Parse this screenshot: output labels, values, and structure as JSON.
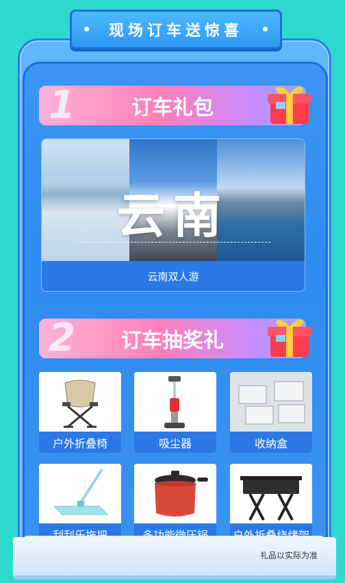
{
  "header": {
    "title": "现场订车送惊喜"
  },
  "section1": {
    "number": "1",
    "title": "订车礼包"
  },
  "yunnan": {
    "overlay": "云南",
    "caption": "云南双人游"
  },
  "section2": {
    "number": "2",
    "title": "订车抽奖礼"
  },
  "prizes": [
    {
      "label": "户外折叠椅",
      "icon": "folding-chair-icon"
    },
    {
      "label": "吸尘器",
      "icon": "vacuum-icon"
    },
    {
      "label": "收纳盒",
      "icon": "storage-box-icon"
    },
    {
      "label": "刮刮乐拖把",
      "icon": "mop-icon"
    },
    {
      "label": "多功能微压锅",
      "icon": "pressure-pot-icon"
    },
    {
      "label": "户外折叠烧烤架",
      "icon": "bbq-grill-icon"
    }
  ],
  "footer": {
    "note": "礼品以实际为准"
  },
  "colors": {
    "background": "#2fd9cd",
    "panel": "#3b96f4",
    "label_bar": "#2a79e6",
    "accent_pink": "#ff7fb7"
  }
}
